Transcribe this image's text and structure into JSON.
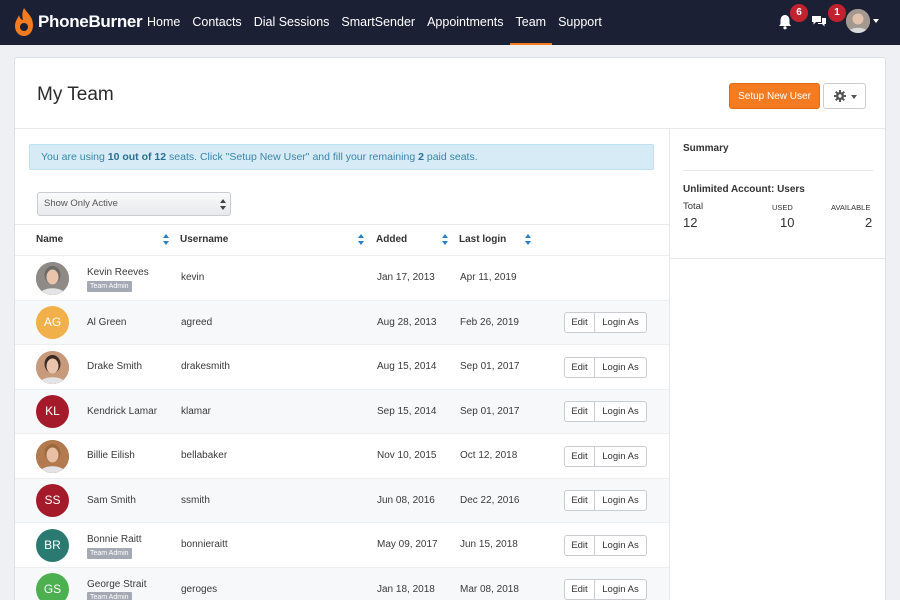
{
  "app": {
    "brand": "PhoneBurner"
  },
  "nav": {
    "items": [
      "Home",
      "Contacts",
      "Dial Sessions",
      "SmartSender",
      "Appointments",
      "Team",
      "Support"
    ],
    "active": "Team",
    "notifications_count": "6",
    "messages_count": "1"
  },
  "page": {
    "title": "My Team",
    "setup_button": "Setup New User",
    "alert": {
      "pre": "You are using ",
      "used": "10 out of 12",
      "mid": " seats. Click \"Setup New User\" and fill your remaining ",
      "remaining": "2",
      "post": " paid seats."
    },
    "filter": "Show Only Active"
  },
  "table": {
    "headers": {
      "name": "Name",
      "username": "Username",
      "added": "Added",
      "last_login": "Last login"
    },
    "edit_label": "Edit",
    "login_as_label": "Login As",
    "tag_label": "Team Admin",
    "rows": [
      {
        "name": "Kevin Reeves",
        "username": "kevin",
        "added": "Jan 17, 2013",
        "last_login": "Apr 11, 2019",
        "initials": "",
        "avatar_color": "#8f8a85",
        "photo": true,
        "admin": true,
        "actions": false
      },
      {
        "name": "Al Green",
        "username": "agreed",
        "added": "Aug 28, 2013",
        "last_login": "Feb 26, 2019",
        "initials": "AG",
        "avatar_color": "#f2b04a",
        "photo": false,
        "admin": false,
        "actions": true
      },
      {
        "name": "Drake Smith",
        "username": "drakesmith",
        "added": "Aug 15, 2014",
        "last_login": "Sep 01, 2017",
        "initials": "",
        "avatar_color": "#c89a7c",
        "photo": true,
        "admin": false,
        "actions": true
      },
      {
        "name": "Kendrick Lamar",
        "username": "klamar",
        "added": "Sep 15, 2014",
        "last_login": "Sep 01, 2017",
        "initials": "KL",
        "avatar_color": "#a51a2b",
        "photo": false,
        "admin": false,
        "actions": true
      },
      {
        "name": "Billie Eilish",
        "username": "bellabaker",
        "added": "Nov 10, 2015",
        "last_login": "Oct 12, 2018",
        "initials": "",
        "avatar_color": "#b27a4e",
        "photo": true,
        "admin": false,
        "actions": true
      },
      {
        "name": "Sam Smith",
        "username": "ssmith",
        "added": "Jun 08, 2016",
        "last_login": "Dec 22, 2016",
        "initials": "SS",
        "avatar_color": "#a51a2b",
        "photo": false,
        "admin": false,
        "actions": true
      },
      {
        "name": "Bonnie Raitt",
        "username": "bonnieraitt",
        "added": "May 09, 2017",
        "last_login": "Jun 15, 2018",
        "initials": "BR",
        "avatar_color": "#2a7a72",
        "photo": false,
        "admin": true,
        "actions": true
      },
      {
        "name": "George Strait",
        "username": "geroges",
        "added": "Jan 18, 2018",
        "last_login": "Mar 08, 2018",
        "initials": "GS",
        "avatar_color": "#4caf50",
        "photo": false,
        "admin": true,
        "actions": true
      }
    ]
  },
  "summary": {
    "title": "Summary",
    "subtitle": "Unlimited Account: Users",
    "total_label": "Total",
    "used_label": "USED",
    "available_label": "AVAILABLE",
    "total": "12",
    "used": "10",
    "available": "2"
  },
  "colors": {
    "accent": "#f47b20",
    "nav_bg": "#1b2034",
    "alert_bg": "#d6ebf5",
    "badge": "#c0232d"
  }
}
